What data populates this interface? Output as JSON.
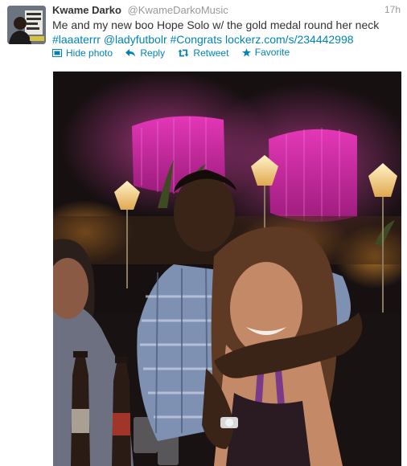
{
  "tweet": {
    "name": "Kwame Darko",
    "handle": "@KwameDarkoMusic",
    "time": "17h",
    "text_plain": "Me and my new boo Hope Solo w/ the gold medal round her neck",
    "hashtag1": "#laaaterrr",
    "mention": "@ladyfutbolr",
    "hashtag2": "#Congrats",
    "url": "lockerz.com/s/234442998"
  },
  "actions": {
    "hide_photo": "Hide photo",
    "reply": "Reply",
    "retweet": "Retweet",
    "favorite": "Favorite"
  },
  "colors": {
    "link": "#0084b4",
    "name": "#333333",
    "meta": "#999999"
  },
  "icons": [
    "photo-icon",
    "reply-icon",
    "retweet-icon",
    "favorite-icon"
  ]
}
